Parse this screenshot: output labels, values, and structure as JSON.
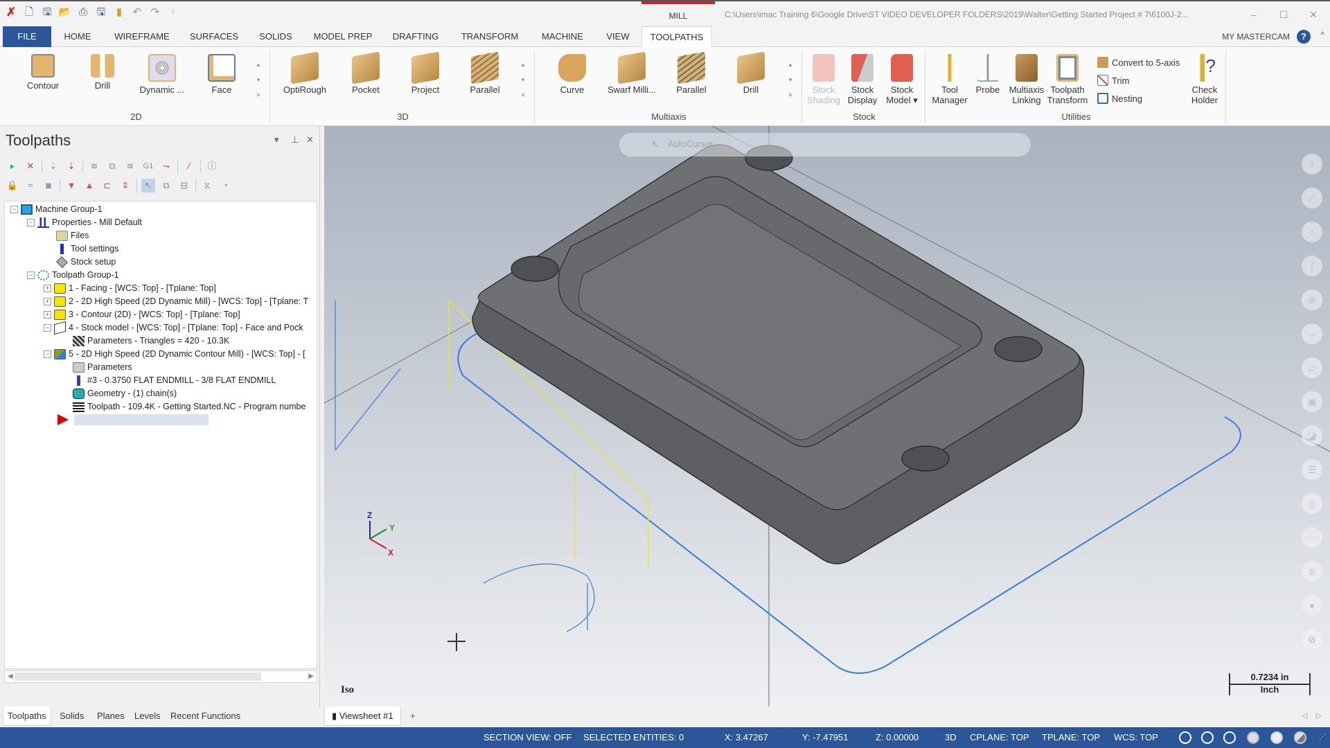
{
  "app": {
    "context_tab": "MILL",
    "file_path": "C:\\Users\\imac Training 6\\Google Drive\\ST VIDEO DEVELOPER FOLDERS\\2019\\Walter\\Getting Started Project # 7\\6100J-2...",
    "window_controls": {
      "minimize": "–",
      "maximize": "☐",
      "close": "✕"
    },
    "quick_access": [
      "mastercam-logo",
      "new-icon",
      "save-icon",
      "open-icon",
      "print-icon",
      "save-as-icon",
      "properties-icon",
      "undo-icon",
      "redo-icon",
      "customize-icon"
    ]
  },
  "menu": {
    "tabs": [
      "FILE",
      "HOME",
      "WIREFRAME",
      "SURFACES",
      "SOLIDS",
      "MODEL PREP",
      "DRAFTING",
      "TRANSFORM",
      "MACHINE",
      "VIEW",
      "TOOLPATHS"
    ],
    "active_tab": "TOOLPATHS",
    "my_mastercam": "MY MASTERCAM",
    "help": "?",
    "collapse": "^"
  },
  "ribbon": {
    "groups": [
      {
        "label": "2D",
        "buttons": [
          "Contour",
          "Drill",
          "Dynamic ...",
          "Face"
        ]
      },
      {
        "label": "3D",
        "buttons": [
          "OptiRough",
          "Pocket",
          "Project",
          "Parallel"
        ]
      },
      {
        "label": "Multiaxis",
        "buttons": [
          "Curve",
          "Swarf Milli...",
          "Parallel",
          "Drill"
        ]
      },
      {
        "label": "Stock",
        "buttons": [
          "Stock Shading",
          "Stock Display",
          "Stock Model ▾"
        ]
      },
      {
        "label": "Utilities",
        "buttons": [
          "Tool Manager",
          "Probe",
          "Multiaxis Linking",
          "Toolpath Transform"
        ],
        "small_buttons": [
          "Convert to 5-axis",
          "Trim",
          "Nesting"
        ],
        "extra": "Check Holder"
      }
    ],
    "colors": {
      "tan": "#d9a55c",
      "stock_red": "#e06050",
      "accent": "#2b579a"
    }
  },
  "panel": {
    "title": "Toolpaths",
    "controls": {
      "dropdown": "▾",
      "pin": "⊥",
      "close": "✕"
    },
    "toolbar_row1": [
      "select-all-ops-icon",
      "deselect-all-icon",
      "regen-all-icon",
      "regen-dirty-icon",
      "backplot-icon",
      "verify-icon",
      "simulate-icon",
      "post-g1-icon",
      "high-speed-icon",
      "delete-ops-icon",
      "help-icon"
    ],
    "toolbar_row2": [
      "lock-icon",
      "toggle-display-icon",
      "toggle-post-icon",
      "move-down-icon",
      "move-up-icon",
      "insert-after-icon",
      "scroll-icon",
      "single-display-icon",
      "display-options-icon",
      "scrollbar-icon",
      "cycle-time-icon"
    ],
    "tree": [
      {
        "label": "Machine Group-1",
        "level": 0,
        "icon": "machine-group-icon",
        "expander": "−"
      },
      {
        "label": "Properties - Mill Default",
        "level": 1,
        "icon": "properties-icon",
        "expander": "−"
      },
      {
        "label": "Files",
        "level": 2,
        "icon": "files-folder-icon"
      },
      {
        "label": "Tool settings",
        "level": 2,
        "icon": "tool-icon"
      },
      {
        "label": "Stock setup",
        "level": 2,
        "icon": "stock-icon"
      },
      {
        "label": "Toolpath Group-1",
        "level": 1,
        "icon": "toolpath-group-icon",
        "expander": "−"
      },
      {
        "label": "1 - Facing - [WCS: Top] - [Tplane: Top]",
        "level": 2,
        "icon": "folder-icon",
        "expander": "+"
      },
      {
        "label": "2 - 2D High Speed (2D Dynamic Mill) - [WCS: Top] - [Tplane: T",
        "level": 2,
        "icon": "folder-icon",
        "expander": "+"
      },
      {
        "label": "3 - Contour (2D) - [WCS: Top] - [Tplane: Top]",
        "level": 2,
        "icon": "folder-icon",
        "expander": "+"
      },
      {
        "label": "4 - Stock model - [WCS: Top] - [Tplane: Top] - Face and Pock",
        "level": 2,
        "icon": "stock-model-icon",
        "expander": "−"
      },
      {
        "label": "Parameters - Triangles = 420 - 10.3K",
        "level": 3,
        "icon": "hatch-icon"
      },
      {
        "label": "5 - 2D High Speed (2D Dynamic Contour Mill) - [WCS: Top] - [",
        "level": 2,
        "icon": "folder-selected-icon",
        "expander": "−"
      },
      {
        "label": "Parameters",
        "level": 3,
        "icon": "parameters-icon"
      },
      {
        "label": "#3 - 0.3750 FLAT ENDMILL - 3/8 FLAT ENDMILL",
        "level": 3,
        "icon": "endmill-icon"
      },
      {
        "label": "Geometry - (1) chain(s)",
        "level": 3,
        "icon": "geometry-icon"
      },
      {
        "label": "Toolpath - 109.4K - Getting Started.NC - Program numbe",
        "level": 3,
        "icon": "toolpath-icon"
      },
      {
        "label": "",
        "level": 2,
        "icon": "insert-arrow-icon"
      }
    ],
    "bottom_tabs": [
      "Toolpaths",
      "Solids",
      "Planes",
      "Levels",
      "Recent Functions"
    ],
    "active_bottom_tab": "Toolpaths"
  },
  "viewport": {
    "view_toolbar_label": "AutoCursor",
    "view_name": "Iso",
    "scale_value": "0.7234 in",
    "scale_unit": "Inch",
    "axes": {
      "x": "X",
      "y": "Y",
      "z": "Z"
    },
    "right_tools": [
      "point-icon",
      "line-icon",
      "circle-icon",
      "spline-icon",
      "solid-icon",
      "dimension-icon",
      "surface-icon",
      "box-icon",
      "boolean-icon",
      "list-icon",
      "analyze-icon",
      "level-icon",
      "layers-icon",
      "shading-icon",
      "no-entry-icon"
    ],
    "colors": {
      "part": "#5e5f62",
      "chain": "#3a7be0",
      "entry": "#e6e62e"
    }
  },
  "viewsheets": {
    "tab": "Viewsheet #1",
    "add": "+",
    "prev": "◁",
    "next": "▷"
  },
  "status": {
    "section_view": "SECTION VIEW: OFF",
    "selected": "SELECTED ENTITIES: 0",
    "x": "X:   3.47267",
    "y": "Y:   -7.47951",
    "z": "Z:   0.00000",
    "mode": "3D",
    "cplane": "CPLANE: TOP",
    "tplane": "TPLANE: TOP",
    "wcs": "WCS: TOP"
  }
}
